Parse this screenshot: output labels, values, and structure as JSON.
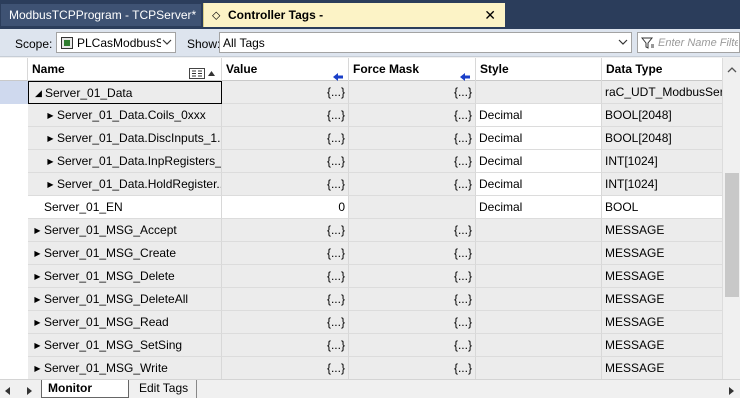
{
  "tabs": {
    "inactive": "ModbusTCPProgram - TCPServer*",
    "active": "Controller Tags - PLCasModbusServer(controller)",
    "close_glyph": "✕",
    "tag_glyph": "⬦"
  },
  "toolbar": {
    "scope_label": "Scope:",
    "scope_value": "PLCasModbusSe",
    "show_label": "Show:",
    "show_value": "All Tags",
    "filter_placeholder": "Enter Name Filter"
  },
  "columns": {
    "name": "Name",
    "value": "Value",
    "force_mask": "Force Mask",
    "style": "Style",
    "data_type": "Data Type"
  },
  "rows": [
    {
      "name": "Server_01_Data",
      "value": "{...}",
      "force": "{...}",
      "style": "",
      "dtype": "raC_UDT_ModbusSer..."
    },
    {
      "name": "Server_01_Data.Coils_0xxx",
      "value": "{...}",
      "force": "{...}",
      "style": "Decimal",
      "dtype": "BOOL[2048]"
    },
    {
      "name": "Server_01_Data.DiscInputs_1...",
      "value": "{...}",
      "force": "{...}",
      "style": "Decimal",
      "dtype": "BOOL[2048]"
    },
    {
      "name": "Server_01_Data.InpRegisters_...",
      "value": "{...}",
      "force": "{...}",
      "style": "Decimal",
      "dtype": "INT[1024]"
    },
    {
      "name": "Server_01_Data.HoldRegister...",
      "value": "{...}",
      "force": "{...}",
      "style": "Decimal",
      "dtype": "INT[1024]"
    },
    {
      "name": "Server_01_EN",
      "value": "0",
      "force": "",
      "style": "Decimal",
      "dtype": "BOOL"
    },
    {
      "name": "Server_01_MSG_Accept",
      "value": "{...}",
      "force": "{...}",
      "style": "",
      "dtype": "MESSAGE"
    },
    {
      "name": "Server_01_MSG_Create",
      "value": "{...}",
      "force": "{...}",
      "style": "",
      "dtype": "MESSAGE"
    },
    {
      "name": "Server_01_MSG_Delete",
      "value": "{...}",
      "force": "{...}",
      "style": "",
      "dtype": "MESSAGE"
    },
    {
      "name": "Server_01_MSG_DeleteAll",
      "value": "{...}",
      "force": "{...}",
      "style": "",
      "dtype": "MESSAGE"
    },
    {
      "name": "Server_01_MSG_Read",
      "value": "{...}",
      "force": "{...}",
      "style": "",
      "dtype": "MESSAGE"
    },
    {
      "name": "Server_01_MSG_SetSing",
      "value": "{...}",
      "force": "{...}",
      "style": "",
      "dtype": "MESSAGE"
    },
    {
      "name": "Server_01_MSG_Write",
      "value": "{...}",
      "force": "{...}",
      "style": "",
      "dtype": "MESSAGE"
    }
  ],
  "bottom_tabs": {
    "monitor": "Monitor Tags",
    "edit": "Edit Tags"
  },
  "colors": {
    "tab_strip": "#2b3d5b",
    "active_tab": "#fcf3c6",
    "toolbar": "#dde4ee",
    "arrow_blue": "#1a3fc8"
  }
}
